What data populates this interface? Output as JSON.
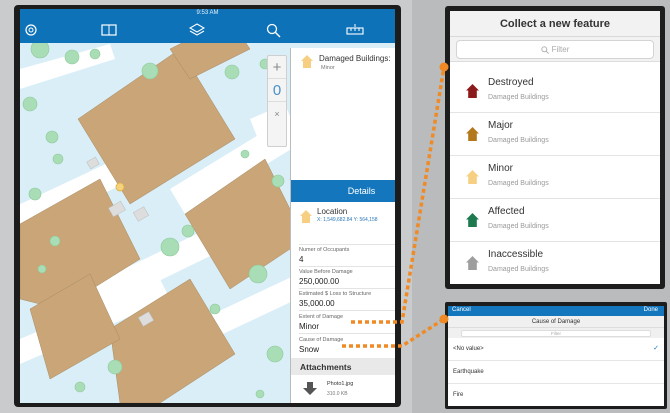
{
  "statusbar": {
    "time": "9:53 AM"
  },
  "toolbar": {
    "icons": [
      "target-icon",
      "book-icon",
      "layers-icon",
      "search-icon",
      "ruler-icon"
    ]
  },
  "map_controls": {
    "zoom_in": "+",
    "compass": "0",
    "close": "×"
  },
  "feature_popup": {
    "title": "Damaged Buildings:",
    "subtitle": "Minor"
  },
  "details": {
    "header": "Details",
    "location_title": "Location",
    "location_coords": "X: 1,549,682.84  Y: 564,158",
    "fields": [
      {
        "label": "Numer of Occupants",
        "value": "4"
      },
      {
        "label": "Value Before Damage",
        "value": "250,000.00"
      },
      {
        "label": "Estimated $ Loss to Structure",
        "value": "35,000.00"
      },
      {
        "label": "Extent of Damage",
        "value": "Minor"
      },
      {
        "label": "Cause of Damage",
        "value": "Snow"
      }
    ],
    "attachments_header": "Attachments",
    "attachment_name": "Photo1.jpg",
    "attachment_size": "310.0 KB"
  },
  "collect": {
    "title": "Collect a new feature",
    "filter_placeholder": "Filter",
    "items": [
      {
        "label": "Destroyed",
        "sub": "Damaged Buildings",
        "color": "#8c1a1a"
      },
      {
        "label": "Major",
        "sub": "Damaged Buildings",
        "color": "#b3771c"
      },
      {
        "label": "Minor",
        "sub": "Damaged Buildings",
        "color": "#f7cf83"
      },
      {
        "label": "Affected",
        "sub": "Damaged Buildings",
        "color": "#1d7a4f"
      },
      {
        "label": "Inaccessible",
        "sub": "Damaged Buildings",
        "color": "#9e9e9e"
      }
    ]
  },
  "cause_picker": {
    "cancel": "Cancel",
    "done": "Done",
    "title": "Cause of Damage",
    "filter_placeholder": "Filter",
    "options": [
      "<No value>",
      "Earthquake",
      "Fire"
    ],
    "selected": "<No value>"
  },
  "colors": {
    "accent": "#0e72b8",
    "connector": "#f08a24",
    "building": "#c9a578"
  }
}
